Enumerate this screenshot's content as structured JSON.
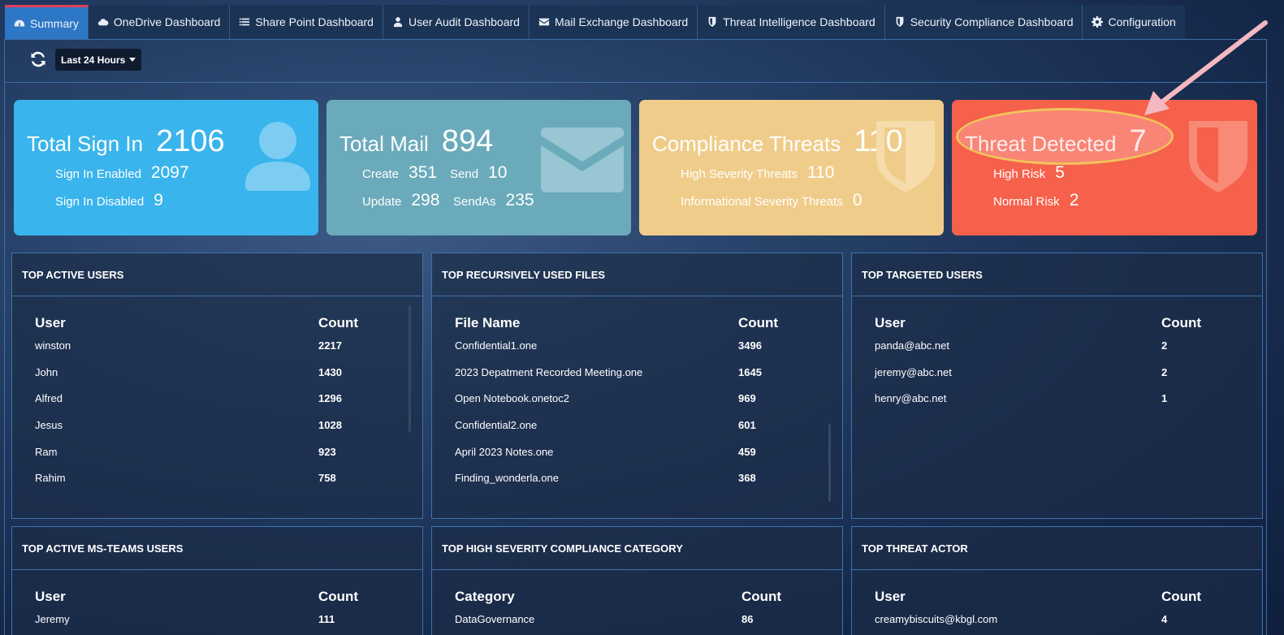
{
  "nav": {
    "tabs": [
      {
        "label": "Summary",
        "icon": "dashboard-icon"
      },
      {
        "label": "OneDrive Dashboard",
        "icon": "cloud-icon"
      },
      {
        "label": "Share Point Dashboard",
        "icon": "list-icon"
      },
      {
        "label": "User Audit Dashboard",
        "icon": "user-icon"
      },
      {
        "label": "Mail Exchange Dashboard",
        "icon": "envelope-icon"
      },
      {
        "label": "Threat Intelligence Dashboard",
        "icon": "shield-icon"
      },
      {
        "label": "Security Compliance Dashboard",
        "icon": "shield-icon"
      },
      {
        "label": "Configuration",
        "icon": "gear-icon"
      }
    ]
  },
  "toolbar": {
    "range_label": "Last 24 Hours"
  },
  "cards": {
    "signin": {
      "title": "Total Sign In",
      "value": "2106",
      "rows": [
        {
          "label": "Sign In Enabled",
          "value": "2097"
        },
        {
          "label": "Sign In Disabled",
          "value": "9"
        }
      ],
      "color": "#3ab4ec"
    },
    "mail": {
      "title": "Total Mail",
      "value": "894",
      "create_label": "Create",
      "create_value": "351",
      "send_label": "Send",
      "send_value": "10",
      "update_label": "Update",
      "update_value": "298",
      "sendas_label": "SendAs",
      "sendas_value": "235",
      "color": "#6aaabb"
    },
    "compliance": {
      "title": "Compliance Threats",
      "value": "110",
      "rows": [
        {
          "label": "High Severity Threats",
          "value": "110"
        },
        {
          "label": "Informational Severity Threats",
          "value": "0"
        }
      ],
      "color": "#f0cc8a"
    },
    "threat": {
      "title": "Threat Detected",
      "value": "7",
      "rows": [
        {
          "label": "High Risk",
          "value": "5"
        },
        {
          "label": "Normal Risk",
          "value": "2"
        }
      ],
      "color": "#f6614b"
    }
  },
  "panels": {
    "active_users": {
      "title": "TOP ACTIVE USERS",
      "col1": "User",
      "col2": "Count",
      "rows": [
        {
          "name": "winston",
          "count": "2217"
        },
        {
          "name": "John",
          "count": "1430"
        },
        {
          "name": "Alfred",
          "count": "1296"
        },
        {
          "name": "Jesus",
          "count": "1028"
        },
        {
          "name": "Ram",
          "count": "923"
        },
        {
          "name": "Rahim",
          "count": "758"
        }
      ]
    },
    "files": {
      "title": "TOP RECURSIVELY USED FILES",
      "col1": "File Name",
      "col2": "Count",
      "rows": [
        {
          "name": "Confidential1.one",
          "count": "3496"
        },
        {
          "name": "2023 Depatment Recorded Meeting.one",
          "count": "1645"
        },
        {
          "name": "Open Notebook.onetoc2",
          "count": "969"
        },
        {
          "name": "Confidential2.one",
          "count": "601"
        },
        {
          "name": "April 2023 Notes.one",
          "count": "459"
        },
        {
          "name": "Finding_wonderla.one",
          "count": "368"
        }
      ]
    },
    "targeted": {
      "title": "TOP TARGETED USERS",
      "col1": "User",
      "col2": "Count",
      "rows": [
        {
          "name": "panda@abc.net",
          "count": "2"
        },
        {
          "name": "jeremy@abc.net",
          "count": "2"
        },
        {
          "name": "henry@abc.net",
          "count": "1"
        }
      ]
    },
    "teams": {
      "title": "TOP ACTIVE MS-TEAMS USERS",
      "col1": "User",
      "col2": "Count",
      "rows": [
        {
          "name": "Jeremy",
          "count": "111"
        }
      ]
    },
    "compliance_category": {
      "title": "TOP HIGH SEVERITY COMPLIANCE CATEGORY",
      "col1": "Category",
      "col2": "Count",
      "rows": [
        {
          "name": "DataGovernance",
          "count": "86"
        }
      ]
    },
    "threat_actor": {
      "title": "TOP THREAT ACTOR",
      "col1": "User",
      "col2": "Count",
      "rows": [
        {
          "name": "creamybiscuits@kbgl.com",
          "count": "4"
        }
      ]
    }
  },
  "colors": {
    "accent": "#2d77c6",
    "annotation": "#f4b8c0",
    "highlight": "#f2c35a"
  }
}
